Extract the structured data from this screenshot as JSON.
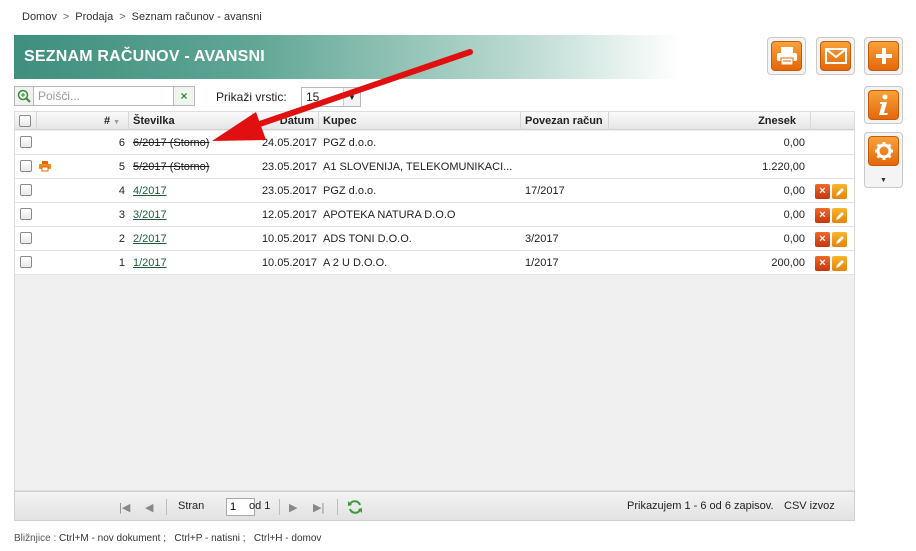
{
  "breadcrumb": {
    "home": "Domov",
    "sales": "Prodaja",
    "current": "Seznam računov - avansni",
    "sep": ">"
  },
  "page": {
    "title": "SEZNAM RAČUNOV - AVANSNI"
  },
  "toolbar": {
    "print": "printer-icon",
    "mail": "envelope-icon",
    "add": "plus-icon",
    "info": "info-icon",
    "settings": "gear-icon"
  },
  "search": {
    "placeholder": "Poišči...",
    "value": "",
    "clear": "×"
  },
  "rows_per_page": {
    "label": "Prikaži vrstic:",
    "value": "15"
  },
  "table": {
    "headers": {
      "num": "#",
      "stevilka": "Številka",
      "datum": "Datum",
      "kupec": "Kupec",
      "povezan": "Povezan račun",
      "znesek": "Znesek"
    },
    "rows": [
      {
        "num": "6",
        "stevilka": "6/2017 (Storno)",
        "datum": "24.05.2017",
        "kupec": "PGZ d.o.o.",
        "povezan": "",
        "znesek": "0,00",
        "storno": true
      },
      {
        "num": "5",
        "stevilka": "5/2017 (Storno)",
        "datum": "23.05.2017",
        "kupec": "A1 SLOVENIJA, TELEKOMUNIKACI...",
        "povezan": "",
        "znesek": "1.220,00",
        "storno": true
      },
      {
        "num": "4",
        "stevilka": "4/2017",
        "datum": "23.05.2017",
        "kupec": "PGZ d.o.o.",
        "povezan": "17/2017",
        "znesek": "0,00",
        "storno": false
      },
      {
        "num": "3",
        "stevilka": "3/2017",
        "datum": "12.05.2017",
        "kupec": "APOTEKA NATURA D.O.O",
        "povezan": "",
        "znesek": "0,00",
        "storno": false
      },
      {
        "num": "2",
        "stevilka": "2/2017",
        "datum": "10.05.2017",
        "kupec": "ADS TONI D.O.O.",
        "povezan": "3/2017",
        "znesek": "0,00",
        "storno": false
      },
      {
        "num": "1",
        "stevilka": "1/2017",
        "datum": "10.05.2017",
        "kupec": "A 2 U D.O.O.",
        "povezan": "1/2017",
        "znesek": "200,00",
        "storno": false
      }
    ]
  },
  "pager": {
    "page_label": "Stran",
    "page": "1",
    "of_label": "od 1",
    "summary": "Prikazujem 1 - 6 od 6 zapisov.",
    "csv": "CSV izvoz"
  },
  "shortcuts": {
    "label": "Bližnjice :",
    "items": "Ctrl+M - nov dokument ;   Ctrl+P - natisni ;   Ctrl+H - domov"
  },
  "colors": {
    "accent": "#3f8f7e",
    "orange": "#e4670a",
    "arrow": "#e01010"
  }
}
